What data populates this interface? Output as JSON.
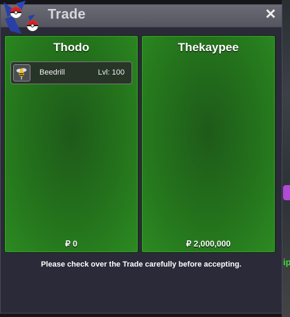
{
  "window": {
    "title": "Trade",
    "close_label": "✕"
  },
  "trade": {
    "left_panel": {
      "trainer": "Thodo",
      "items": [
        {
          "name": "Beedrill",
          "level": "Lvl: 100"
        }
      ],
      "money": "₽ 0"
    },
    "right_panel": {
      "trainer": "Thekaypee",
      "items": [],
      "money": "₽ 2,000,000"
    },
    "notice": "Please check over the Trade carefully before accepting."
  },
  "background": {
    "edge_text": "ip"
  },
  "colors": {
    "panel_green": "#24731c",
    "window_bg": "#2b2a38",
    "titlebar": "#5f5f69"
  },
  "icons": {
    "logo": "trade-logo-icon",
    "close": "close-icon",
    "item_sprite": "beedrill-sprite-icon"
  }
}
